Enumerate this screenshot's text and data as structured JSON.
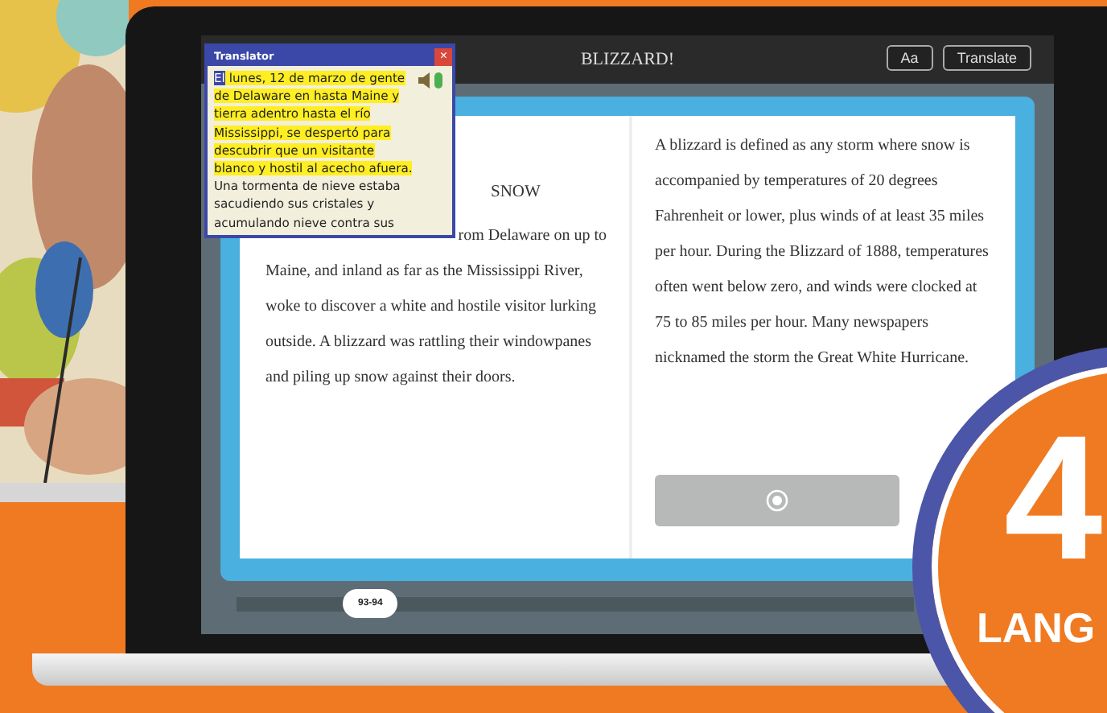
{
  "reader": {
    "title": "BLIZZARD!",
    "buttons": [
      "Aa",
      "Translate"
    ],
    "left_page": {
      "heading": "SNOW",
      "fragment": "rom Delaware on up to",
      "paragraph": "Maine, and inland as far as the Mississippi River, woke to discover a white and hostile visitor lurking outside. A blizzard was rattling their windowpanes and piling up snow against their doors."
    },
    "right_page": {
      "paragraph": "A blizzard is defined as any storm where snow is accompanied by temperatures of 20 degrees Fahrenheit or lower, plus winds of at least 35 miles per hour. During the Blizzard of 1888, temperatures often went below zero, and winds were clocked at 75 to 85 miles per hour. Many newspapers nicknamed the storm the Great White Hurricane."
    },
    "page_slider": {
      "label": "93-94",
      "level": 0.2
    }
  },
  "translator": {
    "title": "Translator",
    "close": "×",
    "selection": "El",
    "lines": [
      {
        "text": " lunes, 12 de marzo de gente",
        "highlighted": true
      },
      {
        "text": "de Delaware en hasta Maine y",
        "highlighted": true
      },
      {
        "text": "tierra adentro hasta el río",
        "highlighted": true
      },
      {
        "text": "Mississippi, se despertó para",
        "highlighted": true
      },
      {
        "text": "descubrir que un visitante",
        "highlighted": true
      },
      {
        "text": "blanco y hostil al acecho afuera.",
        "highlighted": true
      },
      {
        "text": "Una tormenta de nieve estaba",
        "highlighted": false
      },
      {
        "text": "sacudiendo sus cristales y",
        "highlighted": false
      },
      {
        "text": "acumulando nieve contra sus",
        "highlighted": false
      }
    ]
  },
  "badge": {
    "number": "4",
    "text": "LANG"
  }
}
